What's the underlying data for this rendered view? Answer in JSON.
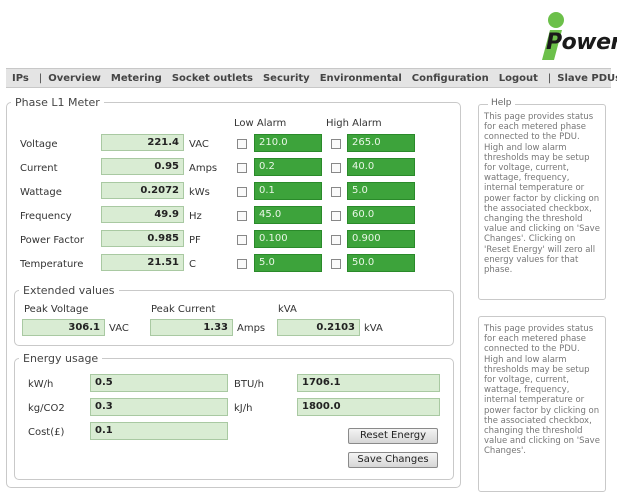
{
  "logo": {
    "text": "Power",
    "accent": "#6cc04a"
  },
  "nav": {
    "items": [
      "IPs",
      "Overview",
      "Metering",
      "Socket outlets",
      "Security",
      "Environmental",
      "Configuration",
      "Logout",
      "Slave PDUs"
    ]
  },
  "meter": {
    "title": "Phase L1 Meter",
    "low_alarm_header": "Low Alarm",
    "high_alarm_header": "High Alarm",
    "rows": [
      {
        "label": "Voltage",
        "value": "221.4",
        "unit": "VAC",
        "low": "210.0",
        "high": "265.0"
      },
      {
        "label": "Current",
        "value": "0.95",
        "unit": "Amps",
        "low": "0.2",
        "high": "40.0"
      },
      {
        "label": "Wattage",
        "value": "0.2072",
        "unit": "kWs",
        "low": "0.1",
        "high": "5.0"
      },
      {
        "label": "Frequency",
        "value": "49.9",
        "unit": "Hz",
        "low": "45.0",
        "high": "60.0"
      },
      {
        "label": "Power Factor",
        "value": "0.985",
        "unit": "PF",
        "low": "0.100",
        "high": "0.900"
      },
      {
        "label": "Temperature",
        "value": "21.51",
        "unit": "C",
        "low": "5.0",
        "high": "50.0"
      }
    ]
  },
  "extended": {
    "title": "Extended values",
    "peak_voltage_label": "Peak Voltage",
    "peak_voltage_value": "306.1",
    "peak_voltage_unit": "VAC",
    "peak_current_label": "Peak Current",
    "peak_current_value": "1.33",
    "peak_current_unit": "Amps",
    "kva_label": "kVA",
    "kva_value": "0.2103",
    "kva_unit": "kVA"
  },
  "energy": {
    "title": "Energy usage",
    "kwh_label": "kW/h",
    "kwh_value": "0.5",
    "btuh_label": "BTU/h",
    "btuh_value": "1706.1",
    "kgco2_label": "kg/CO2",
    "kgco2_value": "0.3",
    "kjh_label": "kJ/h",
    "kjh_value": "1800.0",
    "cost_label": "Cost(£)",
    "cost_value": "0.1",
    "reset_button": "Reset Energy",
    "save_button": "Save Changes"
  },
  "help": {
    "title": "Help",
    "text": "This page provides status for each metered phase connected to the PDU. High and low alarm thresholds may be setup for voltage, current, wattage, frequency, internal temperature or power factor by clicking on the associated checkbox, changing the threshold value and clicking on 'Save Changes'. Clicking on 'Reset Energy' will zero all energy values for that phase.",
    "text2": "This page provides status for each metered phase connected to the PDU. High and low alarm thresholds may be setup for voltage, current, wattage, frequency, internal temperature or power factor by clicking on the associated checkbox, changing the threshold value and clicking on 'Save Changes'."
  }
}
